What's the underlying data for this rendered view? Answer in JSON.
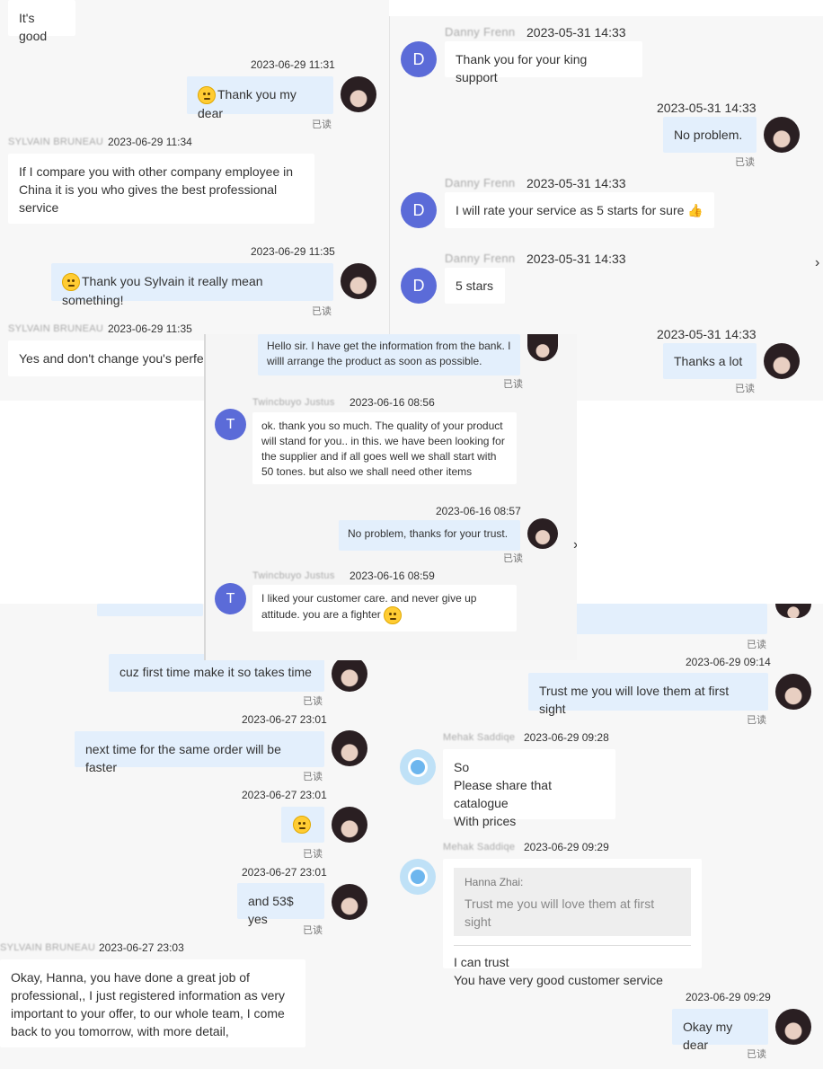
{
  "read_label": "已读",
  "top_left": {
    "msg_good": "It's good",
    "out1": {
      "time": "2023-06-29 11:31",
      "text": "Thank you my dear"
    },
    "in1": {
      "name": "SYLVAIN BRUNEAU",
      "time": "2023-06-29 11:34",
      "text": "If I compare you with other company employee in China it is you who gives the best professional service"
    },
    "out2": {
      "time": "2023-06-29 11:35",
      "text": "Thank you Sylvain it really mean something!"
    },
    "in2": {
      "name": "SYLVAIN BRUNEAU",
      "time": "2023-06-29 11:35",
      "text": "Yes and don't change you's perfec"
    }
  },
  "top_right": {
    "in1": {
      "avatar": "D",
      "name": "Danny Frenn",
      "time": "2023-05-31 14:33",
      "text": "Thank you for your king support"
    },
    "out1": {
      "time": "2023-05-31 14:33",
      "text": "No problem."
    },
    "in2": {
      "avatar": "D",
      "name": "Danny Frenn",
      "time": "2023-05-31 14:33",
      "text": "I will rate your service as 5 starts for sure 👍"
    },
    "in3": {
      "avatar": "D",
      "name": "Danny Frenn",
      "time": "2023-05-31 14:33",
      "text": "5 stars"
    },
    "out2": {
      "time": "2023-05-31 14:33",
      "text": "Thanks a lot"
    }
  },
  "middle": {
    "out0": {
      "text": "Hello sir. I have get the information from the bank. I willl arrange the product as soon as possible."
    },
    "in1": {
      "avatar": "T",
      "name": "Twincbuyo Justus",
      "time": "2023-06-16 08:56",
      "text": "ok. thank you so much. The quality of your product will stand for you.. in this. we have been looking for the supplier and if all goes well we shall start with 50 tones. but also we shall need other items"
    },
    "out1": {
      "time": "2023-06-16 08:57",
      "text": "No problem, thanks for your trust."
    },
    "in2": {
      "avatar": "T",
      "name": "Twincbuyo Justus",
      "time": "2023-06-16 08:59",
      "text": "I liked your customer care. and never give up attitude. you are a fighter"
    }
  },
  "bottom_left": {
    "out1": {
      "text": "cuz first time make it so takes time"
    },
    "out2": {
      "time": "2023-06-27 23:01",
      "text": "next time for the same order will be faster"
    },
    "out3": {
      "time": "2023-06-27 23:01"
    },
    "out4": {
      "time": "2023-06-27 23:01",
      "text": "and 53$ yes"
    },
    "in1": {
      "name": "SYLVAIN BRUNEAU",
      "time": "2023-06-27 23:03",
      "text": "Okay, Hanna, you have done a great job of professional,, I just registered information as very important to your offer, to our whole team, I come back to you tomorrow, with more detail,"
    }
  },
  "bottom_right": {
    "out1": {
      "time": "2023-06-29 09:14",
      "text": "Trust me you will love them at first sight"
    },
    "in1": {
      "name": "Mehak Saddiqe",
      "time": "2023-06-29 09:28",
      "lines": [
        "So",
        "Please share that catalogue",
        "With prices"
      ]
    },
    "in2": {
      "name": "Mehak Saddiqe",
      "time": "2023-06-29 09:29",
      "quote_author": "Hanna Zhai:",
      "quote_text": "Trust me you will love them at first sight",
      "lines": [
        "I can trust",
        "You have very good customer service"
      ]
    },
    "out2": {
      "time": "2023-06-29 09:29",
      "text": "Okay my dear"
    }
  }
}
